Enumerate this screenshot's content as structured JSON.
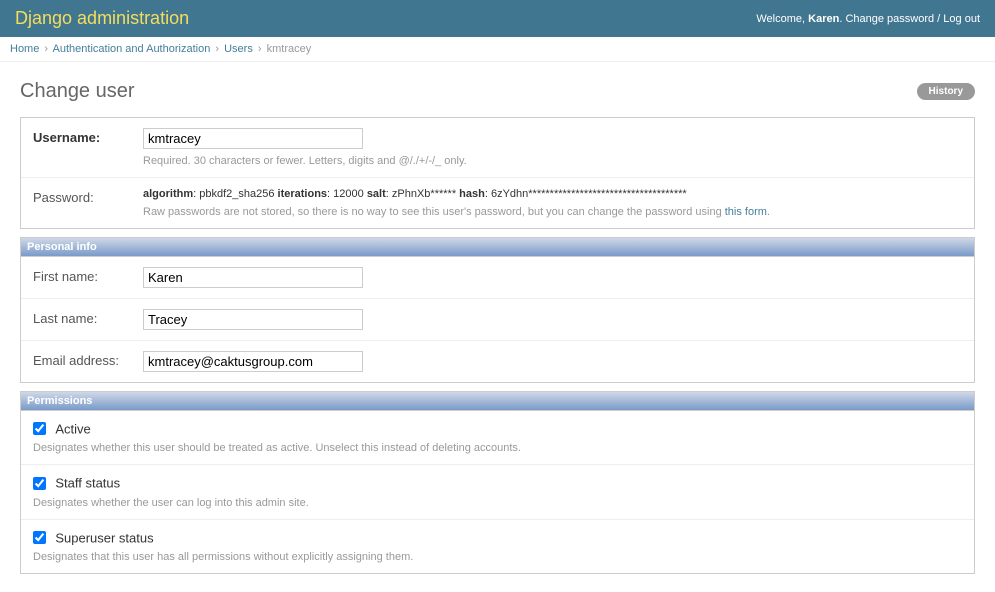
{
  "header": {
    "site_title": "Django administration",
    "welcome_prefix": "Welcome, ",
    "user_name": "Karen",
    "welcome_suffix": ". ",
    "change_password": "Change password",
    "sep": " / ",
    "logout": "Log out"
  },
  "breadcrumbs": {
    "home": "Home",
    "auth": "Authentication and Authorization",
    "users": "Users",
    "current": "kmtracey"
  },
  "page": {
    "title": "Change user",
    "history_label": "History"
  },
  "fields": {
    "username": {
      "label": "Username:",
      "value": "kmtracey",
      "help": "Required. 30 characters or fewer. Letters, digits and @/./+/-/_ only."
    },
    "password": {
      "label": "Password:",
      "algorithm_label": "algorithm",
      "algorithm_value": ": pbkdf2_sha256 ",
      "iterations_label": "iterations",
      "iterations_value": ": 12000 ",
      "salt_label": "salt",
      "salt_value": ": zPhnXb****** ",
      "hash_label": "hash",
      "hash_value": ": 6zYdhn*************************************",
      "help_prefix": "Raw passwords are not stored, so there is no way to see this user's password, but you can change the password using ",
      "help_link": "this form",
      "help_suffix": "."
    }
  },
  "personal": {
    "heading": "Personal info",
    "first_name": {
      "label": "First name:",
      "value": "Karen"
    },
    "last_name": {
      "label": "Last name:",
      "value": "Tracey"
    },
    "email": {
      "label": "Email address:",
      "value": "kmtracey@caktusgroup.com"
    }
  },
  "permissions": {
    "heading": "Permissions",
    "active": {
      "label": "Active",
      "help": "Designates whether this user should be treated as active. Unselect this instead of deleting accounts."
    },
    "staff": {
      "label": "Staff status",
      "help": "Designates whether the user can log into this admin site."
    },
    "superuser": {
      "label": "Superuser status",
      "help": "Designates that this user has all permissions without explicitly assigning them."
    }
  }
}
